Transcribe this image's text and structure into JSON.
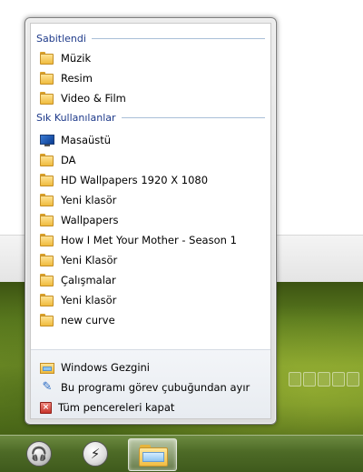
{
  "jumplist": {
    "pinned": {
      "header": "Sabitlendi",
      "items": [
        {
          "label": "Müzik",
          "icon": "folder-icon"
        },
        {
          "label": "Resim",
          "icon": "folder-icon"
        },
        {
          "label": "Video & Film",
          "icon": "folder-icon"
        }
      ]
    },
    "frequent": {
      "header": "Sık Kullanılanlar",
      "items": [
        {
          "label": "Masaüstü",
          "icon": "desktop-icon"
        },
        {
          "label": "DA",
          "icon": "folder-icon"
        },
        {
          "label": "HD Wallpapers 1920 X 1080",
          "icon": "folder-icon"
        },
        {
          "label": "Yeni klasör",
          "icon": "folder-icon"
        },
        {
          "label": "Wallpapers",
          "icon": "folder-icon"
        },
        {
          "label": "How I Met Your Mother - Season 1",
          "icon": "folder-icon"
        },
        {
          "label": "Yeni Klasör",
          "icon": "folder-icon"
        },
        {
          "label": "Çalışmalar",
          "icon": "folder-icon"
        },
        {
          "label": "Yeni klasör",
          "icon": "folder-icon"
        },
        {
          "label": "new curve",
          "icon": "folder-icon"
        }
      ]
    },
    "tasks": [
      {
        "label": "Windows Gezgini",
        "icon": "explorer-icon"
      },
      {
        "label": "Bu programı görev çubuğundan ayır",
        "icon": "pin-icon"
      },
      {
        "label": "Tüm pencereleri kapat",
        "icon": "close-window-icon"
      }
    ]
  },
  "taskbar": {
    "buttons": [
      {
        "icon": "headphones-icon",
        "glyph": "🎧"
      },
      {
        "icon": "lightning-icon",
        "glyph": "⚡"
      },
      {
        "icon": "explorer-folder-icon"
      }
    ]
  }
}
